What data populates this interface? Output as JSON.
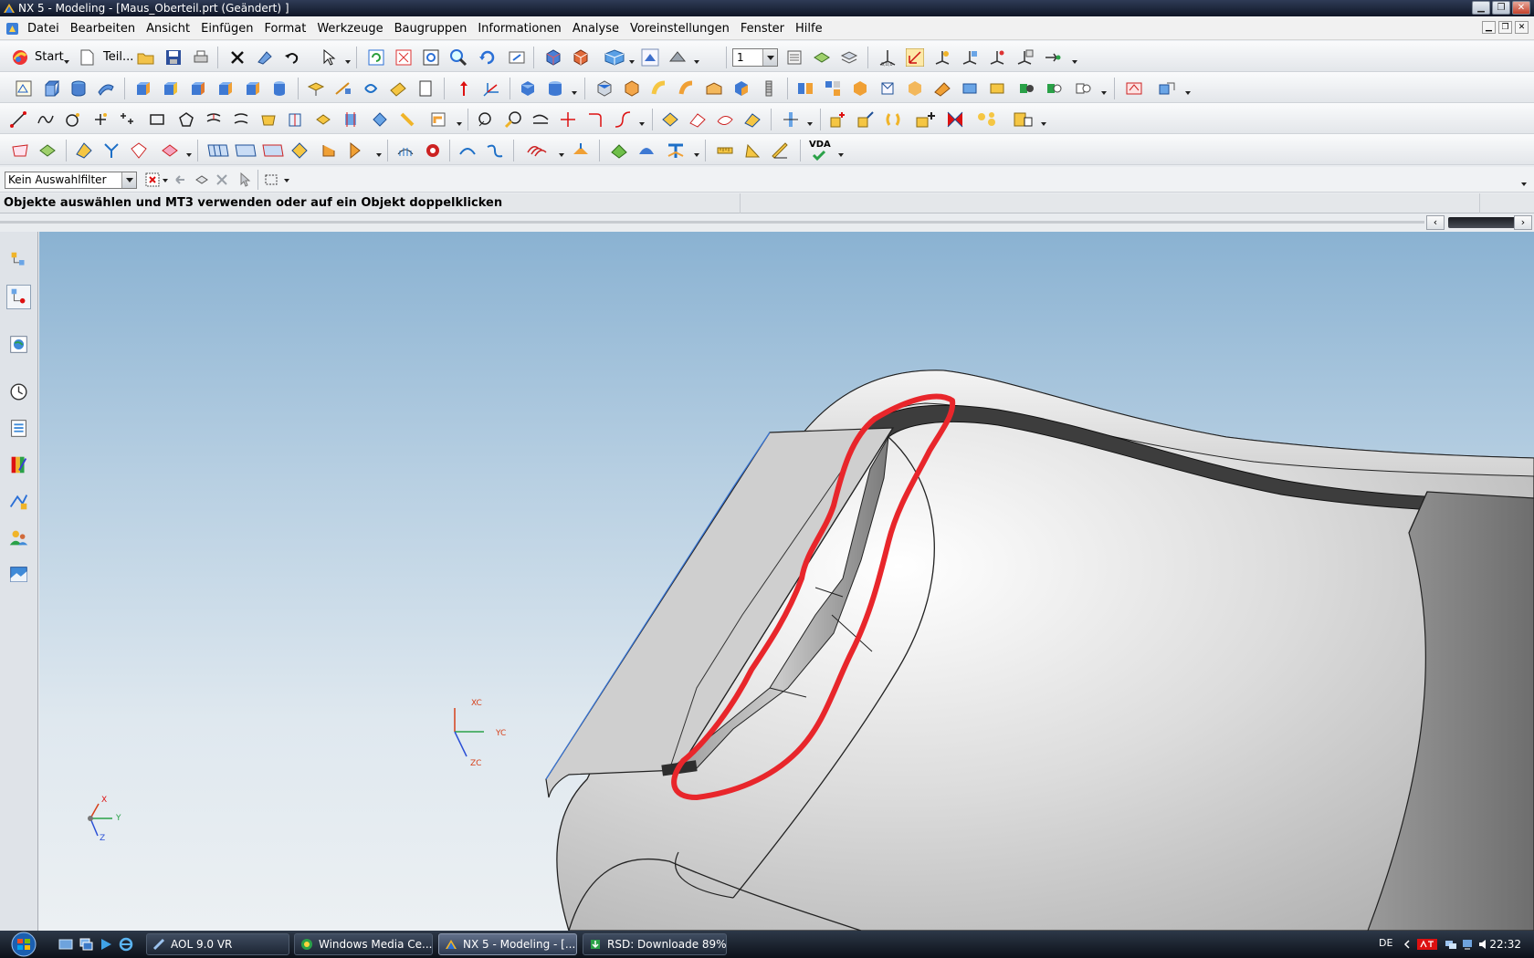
{
  "window": {
    "title": "NX 5 - Modeling - [Maus_Oberteil.prt (Geändert) ]",
    "controls": [
      "minimize-icon",
      "maximize-icon",
      "close-icon"
    ]
  },
  "menu": {
    "items": [
      "Datei",
      "Bearbeiten",
      "Ansicht",
      "Einfügen",
      "Format",
      "Werkzeuge",
      "Baugruppen",
      "Informationen",
      "Analyse",
      "Voreinstellungen",
      "Fenster",
      "Hilfe"
    ]
  },
  "toolbar": {
    "start_label": "Start",
    "part_label": "Teil...",
    "layer_value": "1",
    "vda_label": "VDA"
  },
  "selection": {
    "filter_value": "Kein Auswahlfilter"
  },
  "cue": {
    "text": "Objekte auswählen und MT3 verwenden oder auf ein Objekt doppelklicken"
  },
  "viewport": {
    "wcs_labels": {
      "x": "XC",
      "y": "YC",
      "z": "ZC"
    },
    "abs_labels": {
      "x": "X",
      "y": "Y",
      "z": "Z"
    },
    "annotation_color": "#e8262b"
  },
  "taskbar": {
    "tasks": [
      {
        "label": "AOL 9.0 VR",
        "icon": "aol-icon"
      },
      {
        "label": "Windows Media Ce...",
        "icon": "media-center-icon"
      },
      {
        "label": "NX 5 - Modeling - [...",
        "icon": "nx-icon"
      },
      {
        "label": "RSD: Downloade 89%",
        "icon": "download-icon"
      }
    ],
    "language": "DE",
    "clock": "22:32"
  }
}
